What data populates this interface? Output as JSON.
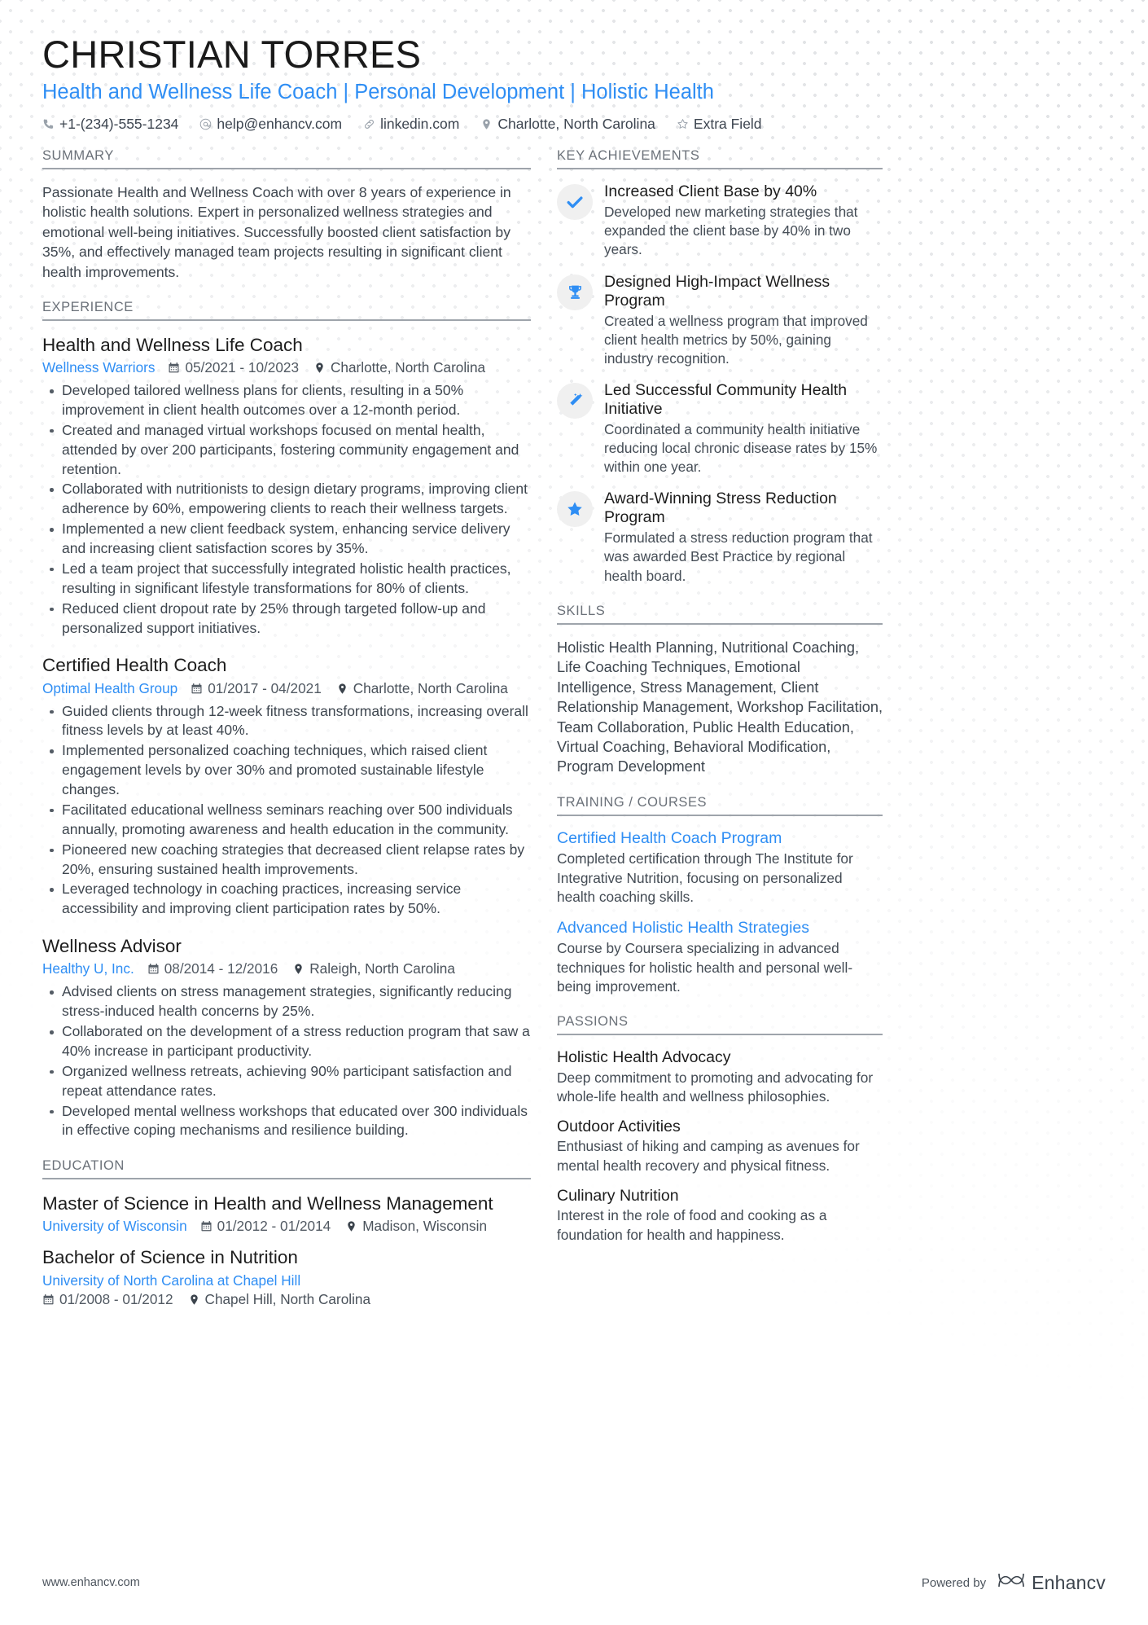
{
  "theme": {
    "accent": "#2f8ef4",
    "text": "#3e464f",
    "heading": "#6b7179",
    "rule": "#9ea4ab",
    "icon_bg": "#f0f0f0"
  },
  "header": {
    "name": "CHRISTIAN TORRES",
    "headline": "Health and Wellness Life Coach | Personal Development | Holistic Health",
    "contacts": [
      {
        "icon": "phone-icon",
        "text": "+1-(234)-555-1234"
      },
      {
        "icon": "email-icon",
        "text": "help@enhancv.com"
      },
      {
        "icon": "link-icon",
        "text": "linkedin.com"
      },
      {
        "icon": "location-icon",
        "text": "Charlotte, North Carolina"
      },
      {
        "icon": "star-outline-icon",
        "text": "Extra Field"
      }
    ]
  },
  "left": {
    "summary": {
      "title": "SUMMARY",
      "text": "Passionate Health and Wellness Coach with over 8 years of experience in holistic health solutions. Expert in personalized wellness strategies and emotional well-being initiatives. Successfully boosted client satisfaction by 35%, and effectively managed team projects resulting in significant client health improvements."
    },
    "experience": {
      "title": "EXPERIENCE",
      "jobs": [
        {
          "role": "Health and Wellness Life Coach",
          "company": "Wellness Warriors",
          "dates": "05/2021 - 10/2023",
          "location": "Charlotte, North Carolina",
          "bullets": [
            "Developed tailored wellness plans for clients, resulting in a 50% improvement in client health outcomes over a 12-month period.",
            "Created and managed virtual workshops focused on mental health, attended by over 200 participants, fostering community engagement and retention.",
            "Collaborated with nutritionists to design dietary programs, improving client adherence by 60%, empowering clients to reach their wellness targets.",
            "Implemented a new client feedback system, enhancing service delivery and increasing client satisfaction scores by 35%.",
            "Led a team project that successfully integrated holistic health practices, resulting in significant lifestyle transformations for 80% of clients.",
            "Reduced client dropout rate by 25% through targeted follow-up and personalized support initiatives."
          ]
        },
        {
          "role": "Certified Health Coach",
          "company": "Optimal Health Group",
          "dates": "01/2017 - 04/2021",
          "location": "Charlotte, North Carolina",
          "bullets": [
            "Guided clients through 12-week fitness transformations, increasing overall fitness levels by at least 40%.",
            "Implemented personalized coaching techniques, which raised client engagement levels by over 30% and promoted sustainable lifestyle changes.",
            "Facilitated educational wellness seminars reaching over 500 individuals annually, promoting awareness and health education in the community.",
            "Pioneered new coaching strategies that decreased client relapse rates by 20%, ensuring sustained health improvements.",
            "Leveraged technology in coaching practices, increasing service accessibility and improving client participation rates by 50%."
          ]
        },
        {
          "role": "Wellness Advisor",
          "company": "Healthy U, Inc.",
          "dates": "08/2014 - 12/2016",
          "location": "Raleigh, North Carolina",
          "bullets": [
            "Advised clients on stress management strategies, significantly reducing stress-induced health concerns by 25%.",
            "Collaborated on the development of a stress reduction program that saw a 40% increase in participant productivity.",
            "Organized wellness retreats, achieving 90% participant satisfaction and repeat attendance rates.",
            "Developed mental wellness workshops that educated over 300 individuals in effective coping mechanisms and resilience building."
          ]
        }
      ]
    },
    "education": {
      "title": "EDUCATION",
      "entries": [
        {
          "degree": "Master of Science in Health and Wellness Management",
          "school": "University of Wisconsin",
          "dates": "01/2012 - 01/2014",
          "location": "Madison, Wisconsin",
          "stacked": false
        },
        {
          "degree": "Bachelor of Science in Nutrition",
          "school": "University of North Carolina at Chapel Hill",
          "dates": "01/2008 - 01/2012",
          "location": "Chapel Hill, North Carolina",
          "stacked": true
        }
      ]
    }
  },
  "right": {
    "achievements": {
      "title": "KEY ACHIEVEMENTS",
      "items": [
        {
          "icon": "check-icon",
          "title": "Increased Client Base by 40%",
          "desc": "Developed new marketing strategies that expanded the client base by 40% in two years."
        },
        {
          "icon": "trophy-icon",
          "title": "Designed High-Impact Wellness Program",
          "desc": "Created a wellness program that improved client health metrics by 50%, gaining industry recognition."
        },
        {
          "icon": "magic-wand-icon",
          "title": "Led Successful Community Health Initiative",
          "desc": "Coordinated a community health initiative reducing local chronic disease rates by 15% within one year."
        },
        {
          "icon": "star-icon",
          "title": "Award-Winning Stress Reduction Program",
          "desc": "Formulated a stress reduction program that was awarded Best Practice by regional health board."
        }
      ]
    },
    "skills": {
      "title": "SKILLS",
      "text": "Holistic Health Planning, Nutritional Coaching, Life Coaching Techniques, Emotional Intelligence, Stress Management, Client Relationship Management, Workshop Facilitation, Team Collaboration, Public Health Education, Virtual Coaching, Behavioral Modification, Program Development"
    },
    "training": {
      "title": "TRAINING / COURSES",
      "items": [
        {
          "name": "Certified Health Coach Program",
          "desc": "Completed certification through The Institute for Integrative Nutrition, focusing on personalized health coaching skills."
        },
        {
          "name": "Advanced Holistic Health Strategies",
          "desc": "Course by Coursera specializing in advanced techniques for holistic health and personal well-being improvement."
        }
      ]
    },
    "passions": {
      "title": "PASSIONS",
      "items": [
        {
          "name": "Holistic Health Advocacy",
          "desc": "Deep commitment to promoting and advocating for whole-life health and wellness philosophies."
        },
        {
          "name": "Outdoor Activities",
          "desc": "Enthusiast of hiking and camping as avenues for mental health recovery and physical fitness."
        },
        {
          "name": "Culinary Nutrition",
          "desc": "Interest in the role of food and cooking as a foundation for health and happiness."
        }
      ]
    }
  },
  "footer": {
    "url": "www.enhancv.com",
    "powered_by": "Powered by",
    "brand": "Enhancv"
  }
}
